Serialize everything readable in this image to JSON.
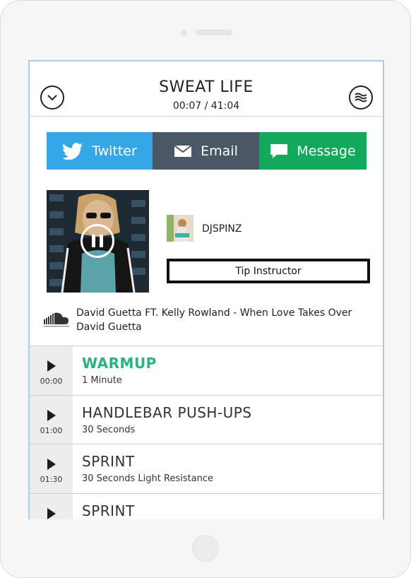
{
  "header": {
    "title": "SWEAT LIFE",
    "timer": "00:07 / 41:04",
    "left_icon": "chevron-down-circle-icon",
    "right_icon": "waves-circle-icon"
  },
  "share": {
    "twitter_label": "Twitter",
    "email_label": "Email",
    "message_label": "Message",
    "colors": {
      "twitter": "#35a7e6",
      "email": "#4a5866",
      "message": "#12a95a"
    }
  },
  "now_playing": {
    "state_icon": "pause-icon",
    "dj_name": "DJSPINZ",
    "tip_label": "Tip Instructor",
    "track_title": "David Guetta FT. Kelly Rowland - When Love Takes Over",
    "track_artist": "David Guetta",
    "source_icon": "soundcloud-icon"
  },
  "playlist": [
    {
      "time": "00:00",
      "name": "WARMUP",
      "desc": "1 Minute",
      "active": true
    },
    {
      "time": "01:00",
      "name": "HANDLEBAR PUSH-UPS",
      "desc": "30 Seconds",
      "active": false
    },
    {
      "time": "01:30",
      "name": "SPRINT",
      "desc": "30 Seconds Light Resistance",
      "active": false
    },
    {
      "time": "",
      "name": "SPRINT",
      "desc": "",
      "active": false
    }
  ],
  "accent_color": "#2ab285"
}
